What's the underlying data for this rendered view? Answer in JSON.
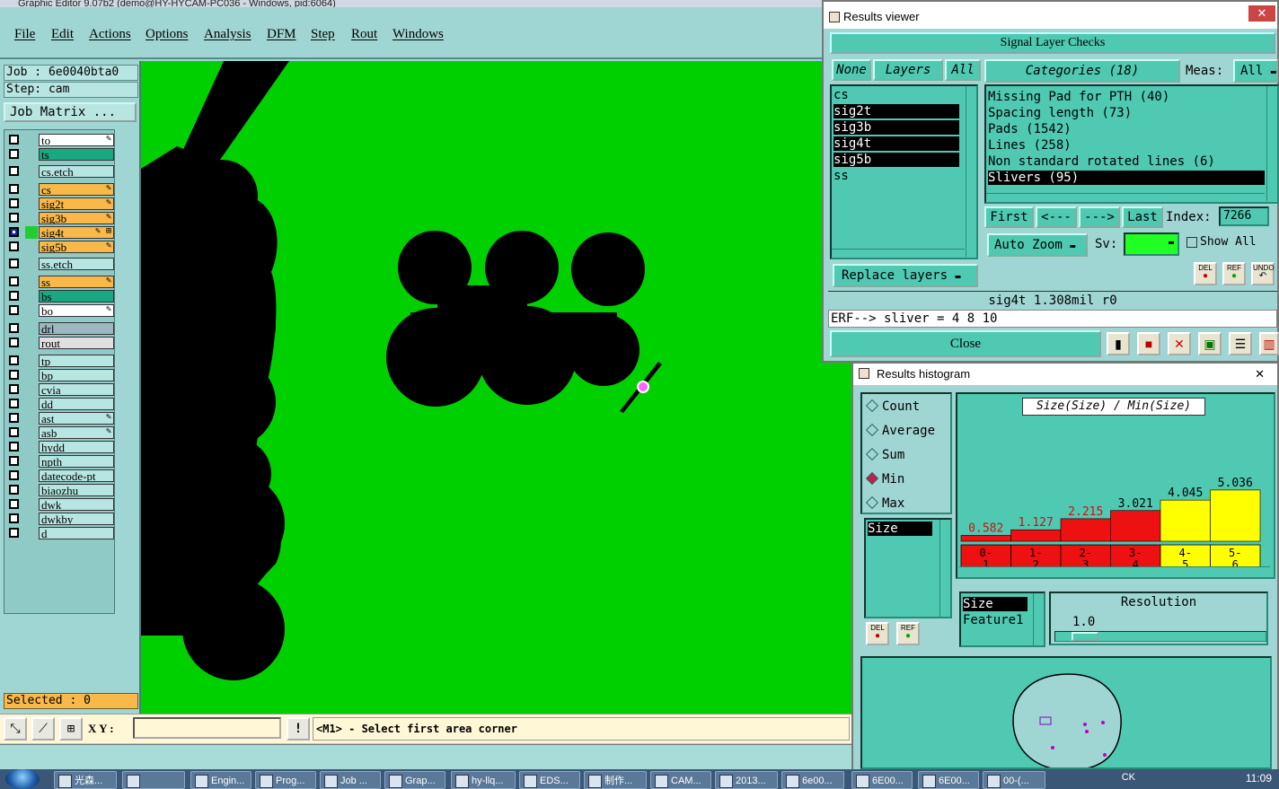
{
  "window": {
    "title": "Graphic Editor 9.07b2 (demo@HY-HYCAM-PC036 - Windows, pid:6064)"
  },
  "menu": [
    "File",
    "Edit",
    "Actions",
    "Options",
    "Analysis",
    "DFM",
    "Step",
    "Rout",
    "Windows"
  ],
  "job": {
    "job_label": "Job : 6e0040bta0",
    "step_label": "Step: cam",
    "matrix_button": "Job Matrix ..."
  },
  "layers": [
    {
      "name": "to",
      "color": "#ffffff",
      "edit": "✎"
    },
    {
      "name": "ts",
      "color": "#1aa882",
      "edit": ""
    },
    {
      "name": "cs.etch",
      "color": "#b7e5e2",
      "edit": ""
    },
    {
      "name": "cs",
      "color": "#f8b84a",
      "edit": "✎"
    },
    {
      "name": "sig2t",
      "color": "#f8b84a",
      "edit": "✎"
    },
    {
      "name": "sig3b",
      "color": "#f8b84a",
      "edit": "✎"
    },
    {
      "name": "sig4t",
      "color": "#f8b84a",
      "edit": "✎ ⊞"
    },
    {
      "name": "sig5b",
      "color": "#f8b84a",
      "edit": "✎"
    },
    {
      "name": "ss.etch",
      "color": "#b7e5e2",
      "edit": ""
    },
    {
      "name": "ss",
      "color": "#f8b84a",
      "edit": "✎"
    },
    {
      "name": "bs",
      "color": "#1aa882",
      "edit": ""
    },
    {
      "name": "bo",
      "color": "#ffffff",
      "edit": "✎"
    },
    {
      "name": "drl",
      "color": "#9fb8c0",
      "edit": ""
    },
    {
      "name": "rout",
      "color": "#e0e0e0",
      "edit": ""
    },
    {
      "name": "tp",
      "color": "#b7e5e2",
      "edit": ""
    },
    {
      "name": "bp",
      "color": "#b7e5e2",
      "edit": ""
    },
    {
      "name": "cvia",
      "color": "#b7e5e2",
      "edit": ""
    },
    {
      "name": "dd",
      "color": "#b7e5e2",
      "edit": ""
    },
    {
      "name": "ast",
      "color": "#b7e5e2",
      "edit": "✎"
    },
    {
      "name": "asb",
      "color": "#b7e5e2",
      "edit": "✎"
    },
    {
      "name": "hydd",
      "color": "#b7e5e2",
      "edit": ""
    },
    {
      "name": "npth",
      "color": "#b7e5e2",
      "edit": ""
    },
    {
      "name": "datecode-pt",
      "color": "#b7e5e2",
      "edit": ""
    },
    {
      "name": "biaozhu",
      "color": "#b7e5e2",
      "edit": ""
    },
    {
      "name": "dwk",
      "color": "#b7e5e2",
      "edit": ""
    },
    {
      "name": "dwkby",
      "color": "#b7e5e2",
      "edit": ""
    },
    {
      "name": "d",
      "color": "#b7e5e2",
      "edit": ""
    }
  ],
  "selected_label": "Selected : 0",
  "cmdbar": {
    "xy_label": "X Y :",
    "excl": "!",
    "prompt": "<M1> - Select first area corner"
  },
  "results_viewer": {
    "title": "Results viewer",
    "close_x": "✕",
    "header": "Signal Layer Checks",
    "btn_none": "None",
    "btn_layers": "Layers",
    "btn_all": "All",
    "categories_btn": "Categories (18)",
    "meas_label": "Meas:",
    "meas_value": "All",
    "layer_items": [
      "cs",
      "sig2t",
      "sig3b",
      "sig4t",
      "sig5b",
      "ss"
    ],
    "category_items": [
      "Missing Pad for PTH (40)",
      "Spacing length (73)",
      "Pads (1542)",
      "Lines (258)",
      "Non standard rotated lines (6)",
      "Slivers (95)"
    ],
    "first": "First",
    "prev": "<---",
    "next": "--->",
    "last": "Last",
    "index_label": "Index:",
    "index_value": "7266",
    "auto_zoom": "Auto Zoom",
    "sv_label": "Sv:",
    "show_all": "Show All",
    "replace_layers": "Replace layers",
    "del": "DEL",
    "ref": "REF",
    "undo": "UNDO",
    "info_line": "sig4t 1.308mil  r0",
    "erf_line": "ERF--> sliver = 4 8 10",
    "close": "Close"
  },
  "histogram": {
    "title": "Results histogram",
    "close_x": "✕",
    "radios": [
      {
        "label": "Count",
        "on": false
      },
      {
        "label": "Average",
        "on": false
      },
      {
        "label": "Sum",
        "on": false
      },
      {
        "label": "Min",
        "on": true
      },
      {
        "label": "Max",
        "on": false
      }
    ],
    "attr_list": [
      "Size"
    ],
    "size_feature_list": [
      "Size",
      "Feature1"
    ],
    "resolution_label": "Resolution",
    "resolution_value": "1.0",
    "del": "DEL",
    "ref": "REF",
    "chart_data": {
      "type": "bar",
      "title": "Size(Size) / Min(Size)",
      "categories": [
        "0-1",
        "1-2",
        "2-3",
        "3-4",
        "4-5",
        "5-6"
      ],
      "category_lines": [
        [
          "0-",
          "1"
        ],
        [
          "1-",
          "2"
        ],
        [
          "2-",
          "3"
        ],
        [
          "3-",
          "4"
        ],
        [
          "4-",
          "5"
        ],
        [
          "5-",
          "6"
        ]
      ],
      "values": [
        0.582,
        1.127,
        2.215,
        3.021,
        4.045,
        5.036
      ],
      "value_labels": [
        "0.582",
        "1.127",
        "2.215",
        "3.021",
        "4.045",
        "5.036"
      ],
      "colors": [
        "#ee1111",
        "#ee1111",
        "#ee1111",
        "#ee1111",
        "#ffff00",
        "#ffff00"
      ],
      "label_colors": [
        "#d01010",
        "#d01010",
        "#d01010",
        "#000000",
        "#000000",
        "#000000"
      ],
      "ylim": [
        0,
        6
      ]
    }
  },
  "taskbar": {
    "items": [
      "光森...",
      "",
      "Engin...",
      "Prog...",
      "Job ...",
      "Grap...",
      "hy-llq...",
      "EDS...",
      "制作...",
      "CAM...",
      "2013...",
      "6e00...",
      "6E00...",
      "6E00...",
      "00-(..."
    ],
    "tray": "CK",
    "clock": "11:09"
  },
  "colors": {
    "board": "#00d000",
    "copper": "#000000",
    "panel": "#9fd6d3",
    "button": "#4fc9b2"
  }
}
